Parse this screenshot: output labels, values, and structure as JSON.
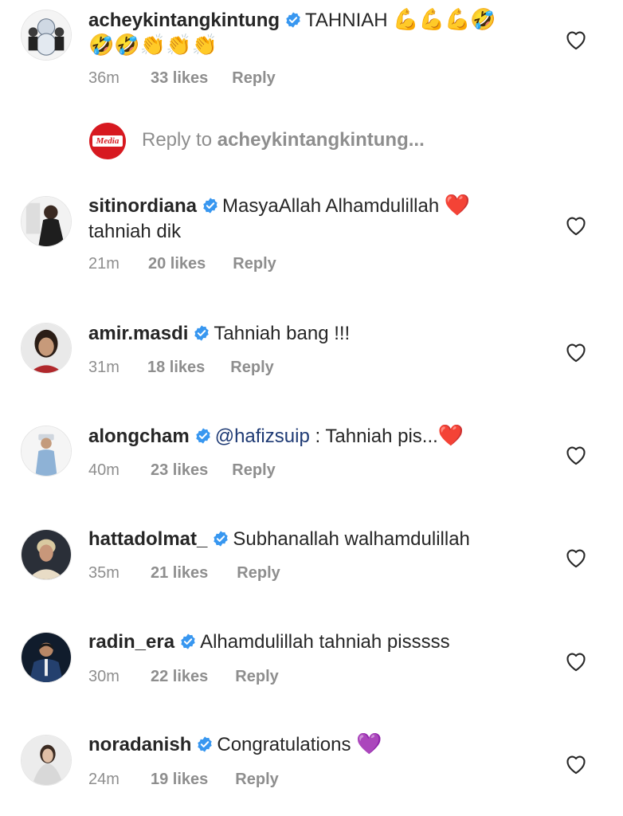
{
  "comments": [
    {
      "username": "acheykintangkintung",
      "text": "TAHNIAH",
      "emoji_line1": "💪💪💪🤣",
      "emoji_line2": "🤣🤣👏👏👏",
      "time": "36m",
      "likes": "33 likes",
      "reply": "Reply"
    },
    {
      "username": "sitinordiana",
      "text": "MasyaAllah Alhamdulillah",
      "emoji": "❤️",
      "text_line2": "tahniah dik",
      "time": "21m",
      "likes": "20 likes",
      "reply": "Reply"
    },
    {
      "username": "amir.masdi",
      "text": "Tahniah bang !!!",
      "time": "31m",
      "likes": "18 likes",
      "reply": "Reply"
    },
    {
      "username": "alongcham",
      "mention": "@hafizsuip",
      "text": " : Tahniah pis...",
      "emoji": "❤️",
      "time": "40m",
      "likes": "23 likes",
      "reply": "Reply"
    },
    {
      "username": "hattadolmat_",
      "text": "Subhanallah walhamdulillah",
      "time": "35m",
      "likes": "21 likes",
      "reply": "Reply"
    },
    {
      "username": "radin_era",
      "text": "Alhamdulillah tahniah pisssss",
      "time": "30m",
      "likes": "22 likes",
      "reply": "Reply"
    },
    {
      "username": "noradanish",
      "text": "Congratulations",
      "emoji": "💜",
      "time": "24m",
      "likes": "19 likes",
      "reply": "Reply"
    }
  ],
  "reply_input": {
    "logo_text": "Media",
    "prefix": "Reply to",
    "target": "acheykintangkintung..."
  },
  "icons": {
    "verified": "verified-badge-icon",
    "like": "heart-outline-icon"
  },
  "colors": {
    "text": "#262626",
    "muted": "#8e8e8e",
    "verified": "#3897f0",
    "mention": "#1e3a74",
    "brand_red": "#d71920"
  }
}
